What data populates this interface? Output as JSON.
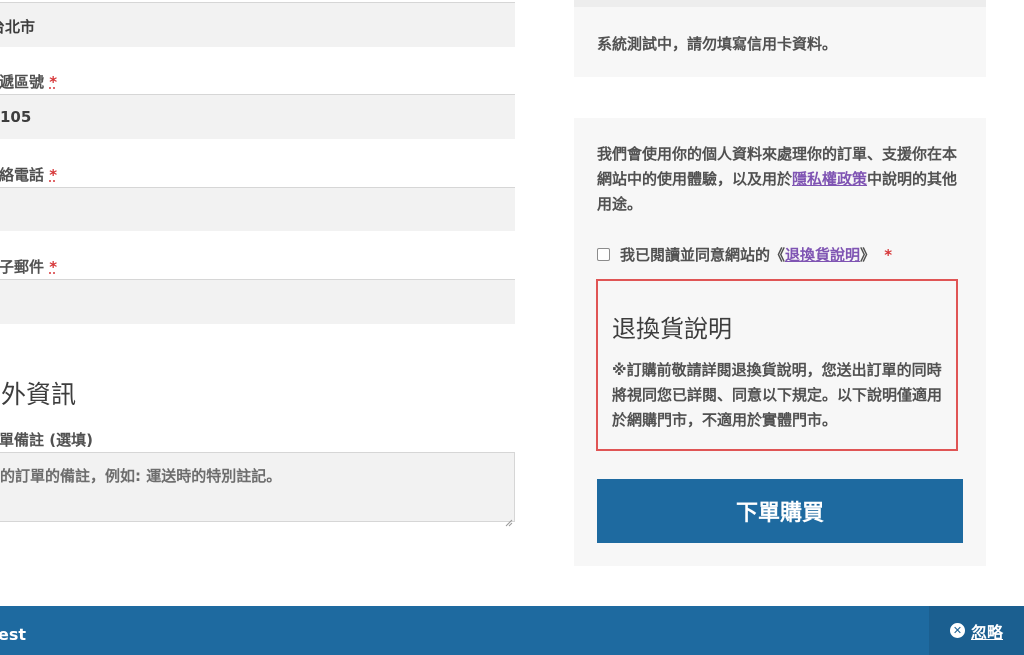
{
  "billing": {
    "city_value": "台北市",
    "postcode_label": "郵遞區號",
    "postcode_value": "105",
    "phone_label": "聯絡電話",
    "email_label": "電子郵件",
    "required_mark": "*"
  },
  "additional": {
    "heading": "額外資訊",
    "notes_label": "訂單備註 (選填)",
    "notes_placeholder": "您的訂單的備註，例如: 運送時的特別註記。"
  },
  "payment": {
    "test_notice": "系統測試中，請勿填寫信用卡資料。"
  },
  "privacy": {
    "text_before": "我們會使用你的個人資料來處理你的訂單、支援你在本網站中的使用體驗，以及用於",
    "link": "隱私權政策",
    "text_after": "中說明的其他用途。"
  },
  "terms": {
    "agree_before": "我已閱讀並同意網站的《",
    "agree_link": "退換貨說明",
    "agree_after": "》",
    "required_mark": "*",
    "box_title": "退換貨說明",
    "box_body": "※訂購前敬請詳閱退換貨說明，您送出訂單的同時將視同您已詳閱、同意以下規定。以下說明僅適用於網購門市，不適用於實體門市。"
  },
  "place_order_label": "下單購買",
  "store_notice": {
    "text": "est",
    "dismiss_label": "忽略",
    "dismiss_icon": "close-circle-icon"
  },
  "colors": {
    "primary": "#1e6aa0",
    "link": "#7f54b3",
    "required": "#d63638",
    "terms_border": "#e05555"
  }
}
